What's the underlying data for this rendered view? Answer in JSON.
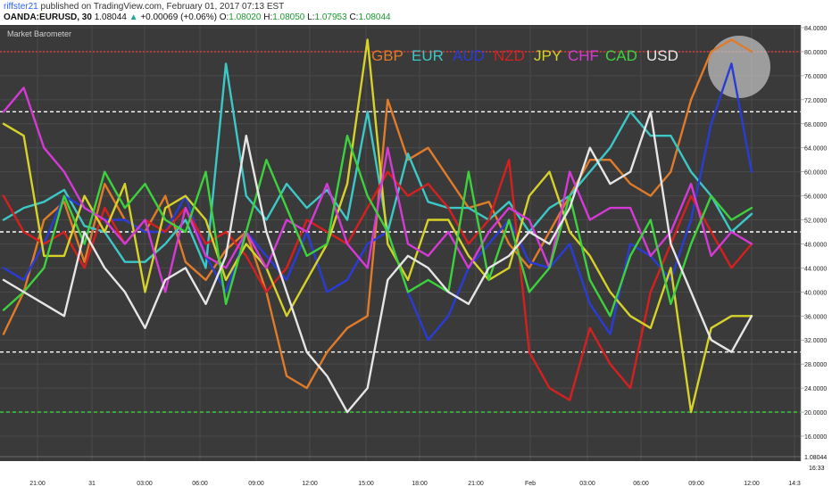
{
  "header": {
    "author": "riffster21",
    "published": "published on TradingView.com, February 01, 2017 07:13 EST",
    "symbol": "OANDA:EURUSD, 30",
    "price": "1.08044",
    "change": "+0.00069 (+0.06%)",
    "open_label": "O:",
    "open": "1.08020",
    "high_label": "H:",
    "high": "1.08050",
    "low_label": "L:",
    "low": "1.07953",
    "close_label": "C:",
    "close": "1.08044"
  },
  "chart_data": {
    "type": "line",
    "title": "Market Barometer",
    "ylim": [
      14,
      84
    ],
    "yticks": [
      "84.0000",
      "80.0000",
      "76.0000",
      "72.0000",
      "68.0000",
      "64.0000",
      "60.0000",
      "56.0000",
      "52.0000",
      "48.0000",
      "44.0000",
      "40.0000",
      "36.0000",
      "32.0000",
      "28.0000",
      "24.0000",
      "20.0000",
      "16.0000"
    ],
    "price_tag": "1.08044",
    "time_tag": "16:33",
    "xticks": [
      "21:00",
      "31",
      "03:00",
      "06:00",
      "09:00",
      "12:00",
      "15:00",
      "18:00",
      "21:00",
      "Feb",
      "03:00",
      "06:00",
      "09:00",
      "12:00",
      "14:3"
    ],
    "levels": [
      {
        "value": 80,
        "color": "#e53935",
        "style": "dotted"
      },
      {
        "value": 70,
        "color": "#ffffff",
        "style": "dashed"
      },
      {
        "value": 50,
        "color": "#ffffff",
        "style": "dashed"
      },
      {
        "value": 30,
        "color": "#ffffff",
        "style": "dashed"
      },
      {
        "value": 20,
        "color": "#3dd23d",
        "style": "dashed"
      }
    ],
    "legend": "top-center",
    "grid": true,
    "series": [
      {
        "name": "GBP",
        "color": "#e07b2a",
        "values": [
          33,
          40,
          52,
          55,
          45,
          58,
          52,
          50,
          56,
          45,
          42,
          47,
          50,
          40,
          26,
          24,
          30,
          34,
          36,
          72,
          62,
          64,
          59,
          54,
          55,
          48,
          44,
          50,
          56,
          62,
          62,
          58,
          56,
          60,
          72,
          80,
          82,
          80
        ]
      },
      {
        "name": "EUR",
        "color": "#3dc8c8",
        "values": [
          52,
          54,
          55,
          57,
          51,
          50,
          45,
          45,
          48,
          52,
          44,
          78,
          56,
          52,
          58,
          54,
          57,
          52,
          70,
          50,
          63,
          55,
          54,
          54,
          52,
          55,
          50,
          54,
          56,
          60,
          64,
          70,
          66,
          66,
          60,
          56,
          50,
          53
        ]
      },
      {
        "name": "AUD",
        "color": "#2a3cd6",
        "values": [
          44,
          42,
          48,
          56,
          54,
          52,
          52,
          50,
          50,
          56,
          46,
          40,
          50,
          46,
          42,
          50,
          40,
          42,
          48,
          50,
          40,
          32,
          36,
          44,
          48,
          52,
          45,
          44,
          48,
          38,
          33,
          48,
          46,
          42,
          52,
          68,
          78,
          60
        ]
      },
      {
        "name": "NZD",
        "color": "#d62020",
        "values": [
          56,
          50,
          48,
          50,
          44,
          54,
          48,
          52,
          50,
          54,
          48,
          50,
          46,
          40,
          44,
          52,
          50,
          48,
          54,
          60,
          56,
          58,
          54,
          48,
          52,
          62,
          30,
          24,
          22,
          34,
          28,
          24,
          40,
          48,
          56,
          50,
          44,
          48
        ]
      },
      {
        "name": "JPY",
        "color": "#d6d22a",
        "values": [
          68,
          66,
          46,
          46,
          56,
          50,
          58,
          40,
          54,
          56,
          52,
          42,
          48,
          44,
          36,
          42,
          48,
          58,
          82,
          48,
          42,
          52,
          52,
          46,
          42,
          44,
          56,
          60,
          50,
          46,
          40,
          36,
          34,
          44,
          20,
          34,
          36,
          36
        ]
      },
      {
        "name": "CHF",
        "color": "#d63ad6",
        "values": [
          70,
          74,
          64,
          60,
          54,
          52,
          48,
          52,
          40,
          54,
          46,
          44,
          50,
          44,
          52,
          50,
          58,
          48,
          44,
          64,
          48,
          46,
          50,
          44,
          50,
          54,
          52,
          44,
          60,
          52,
          54,
          54,
          46,
          50,
          58,
          46,
          50,
          48
        ]
      },
      {
        "name": "CAD",
        "color": "#3dd23d",
        "values": [
          37,
          40,
          44,
          56,
          48,
          60,
          54,
          58,
          52,
          50,
          60,
          38,
          50,
          62,
          54,
          46,
          48,
          66,
          56,
          50,
          40,
          42,
          40,
          60,
          42,
          52,
          40,
          44,
          56,
          42,
          36,
          46,
          52,
          38,
          48,
          56,
          52,
          54
        ]
      },
      {
        "name": "USD",
        "color": "#e6e6e6",
        "values": [
          42,
          40,
          38,
          36,
          50,
          44,
          40,
          34,
          42,
          44,
          38,
          46,
          66,
          50,
          40,
          30,
          26,
          20,
          24,
          42,
          46,
          44,
          40,
          38,
          44,
          46,
          50,
          48,
          54,
          64,
          58,
          60,
          70,
          48,
          40,
          32,
          30,
          36
        ]
      }
    ]
  }
}
